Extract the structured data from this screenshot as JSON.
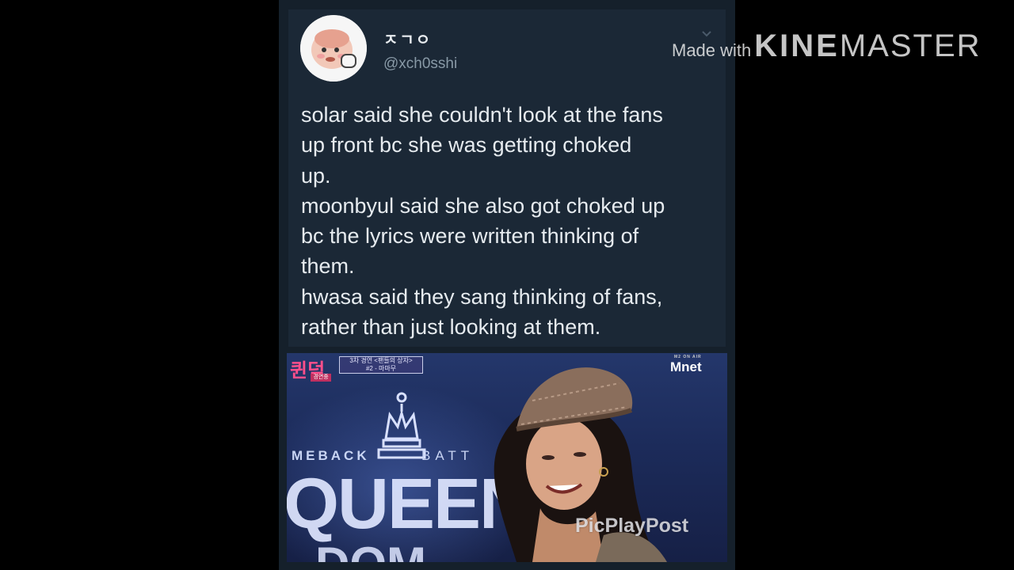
{
  "tweet": {
    "display_name": "ㅈㄱㅇ",
    "handle": "@xch0sshi",
    "lines": [
      "solar said she couldn't look at the fans",
      "up front bc she was getting choked",
      "up.",
      "moonbyul said she also got choked up",
      "bc the lyrics were written thinking of",
      "them.",
      "hwasa said they sang thinking of fans,",
      "rather than just looking at them."
    ]
  },
  "media": {
    "show_logo": "퀸덤",
    "caption_line1": "3차 경연 <팬들의 상자>",
    "caption_line2": "#2 - 마마무",
    "tag": "경연중",
    "broadcaster": "Mnet",
    "broadcaster_small": "M2 ON AIR",
    "backdrop_left": "MEBACK",
    "backdrop_right": "BATT",
    "backdrop_big": "QUEEN",
    "backdrop_big2": "DOM",
    "app_watermark": "PicPlayPost"
  },
  "watermark": {
    "made_with": "Made with",
    "brand_bold": "KINE",
    "brand_light": "MASTER"
  },
  "colors": {
    "background": "#000000",
    "tweet_bg": "#1b2836",
    "text": "#e6ebef",
    "handle": "#8899a6"
  },
  "icons": {
    "avatar": "cartoon-avatar",
    "caret": "chevron-down-icon"
  }
}
